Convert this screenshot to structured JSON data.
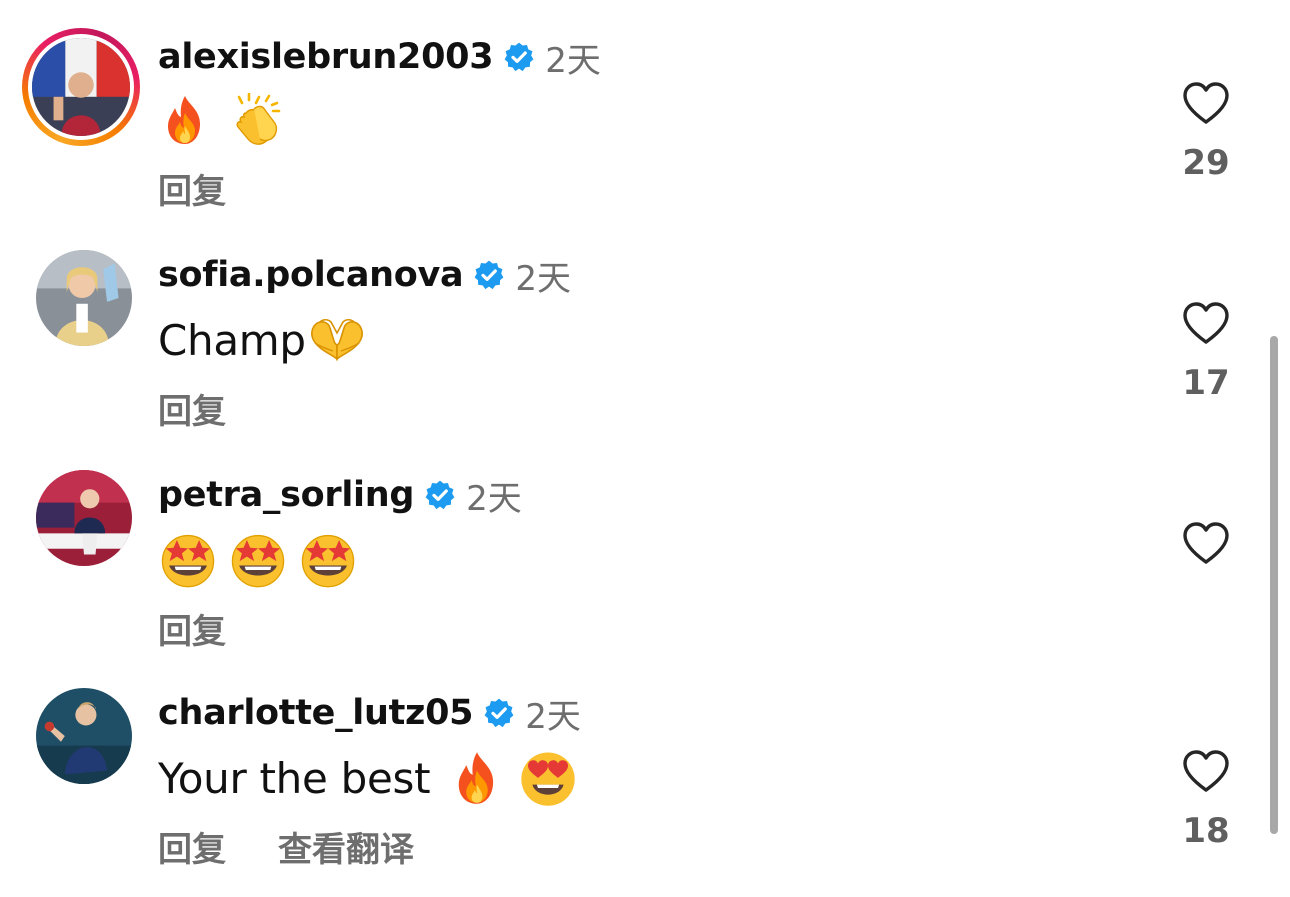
{
  "comments": [
    {
      "username": "alexislebrun2003",
      "verified": true,
      "time": "2天",
      "text": "",
      "emojis": [
        "fire-emoji",
        "clapping-hands-emoji"
      ],
      "reply_label": "回复",
      "likes": "29",
      "has_story_ring": true
    },
    {
      "username": "sofia.polcanova",
      "verified": true,
      "time": "2天",
      "text": "Champ",
      "emojis": [
        "heart-hands-emoji"
      ],
      "reply_label": "回复",
      "likes": "17",
      "has_story_ring": false
    },
    {
      "username": "petra_sorling",
      "verified": true,
      "time": "2天",
      "text": "",
      "emojis": [
        "star-struck-emoji",
        "star-struck-emoji",
        "star-struck-emoji"
      ],
      "reply_label": "回复",
      "likes": "",
      "has_story_ring": false
    },
    {
      "username": "charlotte_lutz05",
      "verified": true,
      "time": "2天",
      "text": "Your the best",
      "emojis": [
        "fire-emoji",
        "heart-eyes-emoji"
      ],
      "reply_label": "回复",
      "translate_label": "查看翻译",
      "likes": "18",
      "has_story_ring": false
    }
  ],
  "colors": {
    "verified_blue": "#1d9bf0",
    "secondary_text": "#6e6e6e",
    "primary_text": "#111111",
    "heart_stroke": "#262626"
  }
}
